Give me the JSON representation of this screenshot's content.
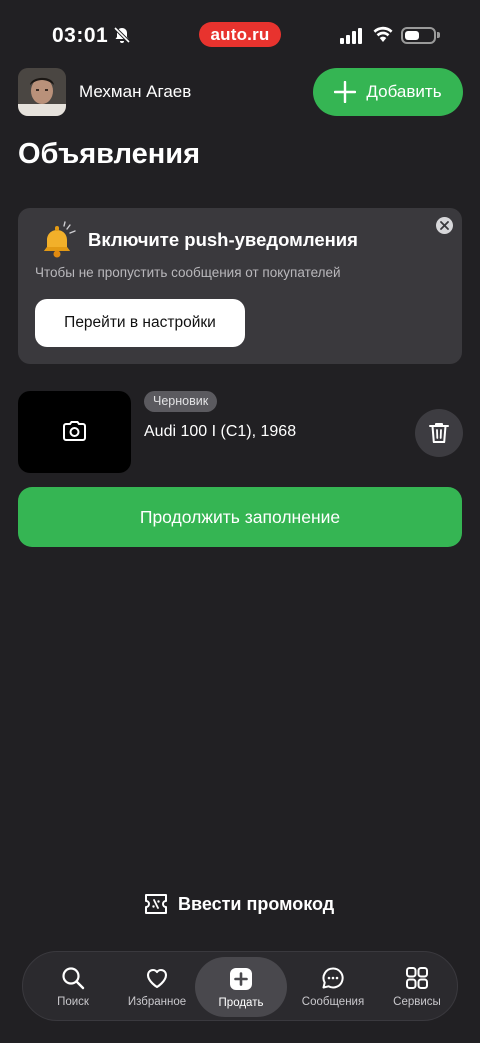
{
  "status_bar": {
    "time": "03:01",
    "brand": "auto.ru",
    "icons": [
      "bell-off-icon",
      "cellular-signal-icon",
      "wifi-icon",
      "battery-icon"
    ]
  },
  "header": {
    "user_name": "Мехман Агаев",
    "add_label": "Добавить"
  },
  "page_title": "Объявления",
  "push_card": {
    "title": "Включите push-уведомления",
    "subtitle": "Чтобы не пропустить сообщения от покупателей",
    "button_label": "Перейти в настройки"
  },
  "listing": {
    "badge": "Черновик",
    "title": "Audi 100 I (C1), 1968",
    "continue_label": "Продолжить заполнение"
  },
  "promo": {
    "label": "Ввести промокод"
  },
  "bottom_nav": {
    "items": [
      {
        "label": "Поиск",
        "icon": "search-icon"
      },
      {
        "label": "Избранное",
        "icon": "heart-icon"
      },
      {
        "label": "Продать",
        "icon": "plus-square-icon",
        "active": true
      },
      {
        "label": "Сообщения",
        "icon": "chat-icon"
      },
      {
        "label": "Сервисы",
        "icon": "grid-icon"
      }
    ]
  },
  "colors": {
    "background": "#212023",
    "accent_green": "#35b553",
    "brand_red": "#e8332e",
    "card": "#3a393d"
  }
}
